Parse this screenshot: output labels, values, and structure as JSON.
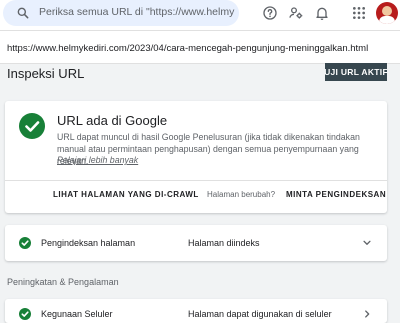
{
  "search": {
    "placeholder": "Periksa semua URL di \"https://www.helmyk"
  },
  "header_icons": [
    "help-icon",
    "manage-accounts-icon",
    "notifications-icon",
    "apps-icon"
  ],
  "url": "https://www.helmykediri.com/2023/04/cara-mencegah-pengunjung-meninggalkan.html",
  "page_title": "Inspeksi URL",
  "test_live_label": "UJI URL AKTIF",
  "status_card": {
    "title": "URL ada di Google",
    "description": "URL dapat muncul di hasil Google Penelusuran (jika tidak dikenakan tindakan manual atau permintaan penghapusan) dengan semua penyempurnaan yang relevan.",
    "learn_more": "Pelajari lebih banyak",
    "view_crawled": "LIHAT HALAMAN YANG DI-CRAWL",
    "page_changed": "Halaman berubah?",
    "request_indexing": "MINTA PENGINDEKSAN"
  },
  "indexing_row": {
    "label": "Pengindeksan halaman",
    "value": "Halaman diindeks"
  },
  "enhancements_label": "Peningkatan & Pengalaman",
  "mobile_row": {
    "label": "Kegunaan Seluler",
    "value": "Halaman dapat digunakan di seluler"
  },
  "colors": {
    "success": "#188038",
    "accent_button": "#37474f",
    "search_bg": "#e8f0fe"
  }
}
